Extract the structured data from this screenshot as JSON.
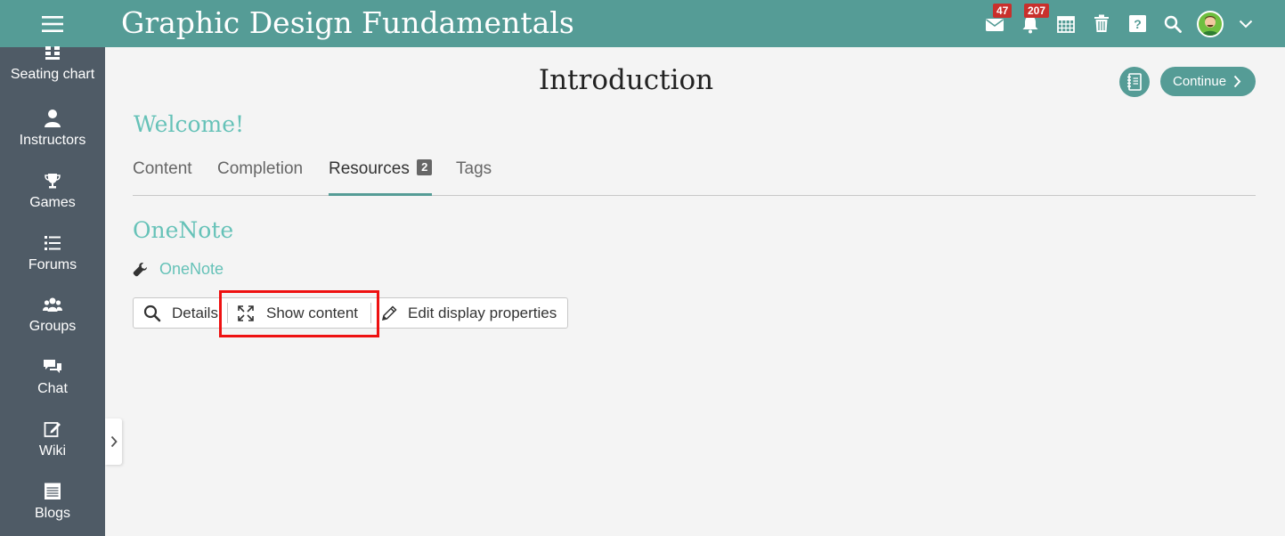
{
  "header": {
    "title": "Graphic Design Fundamentals",
    "messages_count": "47",
    "notifications_count": "207"
  },
  "sidebar": {
    "items": [
      {
        "label": "Seating chart",
        "icon": "seating-chart-icon"
      },
      {
        "label": "Instructors",
        "icon": "person-icon"
      },
      {
        "label": "Games",
        "icon": "trophy-icon"
      },
      {
        "label": "Forums",
        "icon": "list-icon"
      },
      {
        "label": "Groups",
        "icon": "group-icon"
      },
      {
        "label": "Chat",
        "icon": "chat-icon"
      },
      {
        "label": "Wiki",
        "icon": "edit-icon"
      },
      {
        "label": "Blogs",
        "icon": "blog-icon"
      }
    ]
  },
  "main": {
    "page_title": "Introduction",
    "continue_label": "Continue",
    "section_title": "Welcome!",
    "tabs": [
      {
        "label": "Content"
      },
      {
        "label": "Completion"
      },
      {
        "label": "Resources",
        "badge": "2",
        "active": true
      },
      {
        "label": "Tags"
      }
    ],
    "resource": {
      "heading": "OneNote",
      "link_label": "OneNote",
      "actions": {
        "details": "Details",
        "show_content": "Show content",
        "edit_display": "Edit display properties"
      }
    }
  },
  "colors": {
    "brand": "#559c96",
    "accent_text": "#66c2b8",
    "sidebar": "#4f5b66",
    "badge": "#c9302c",
    "highlight": "#ee1111"
  }
}
